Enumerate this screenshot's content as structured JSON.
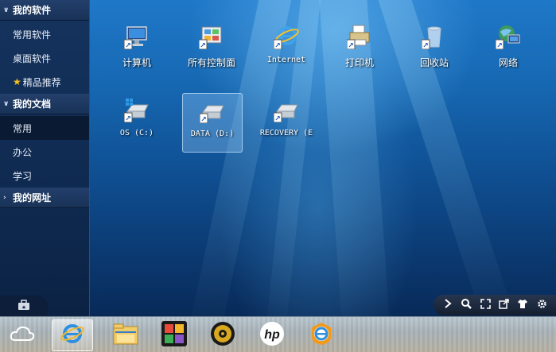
{
  "sidebar": {
    "sections": [
      {
        "title": "我的软件",
        "items": [
          "常用软件",
          "桌面软件",
          "精品推荐"
        ]
      },
      {
        "title": "我的文档",
        "items": [
          "常用",
          "办公",
          "学习"
        ]
      },
      {
        "title": "我的网址",
        "items": []
      }
    ]
  },
  "desktop": {
    "icons": [
      {
        "label": "计算机",
        "icon": "computer-icon"
      },
      {
        "label": "所有控制面",
        "icon": "control-panel-icon"
      },
      {
        "label": "Internet",
        "icon": "ie-icon"
      },
      {
        "label": "打印机",
        "icon": "printer-icon"
      },
      {
        "label": "回收站",
        "icon": "recycle-bin-icon"
      },
      {
        "label": "网络",
        "icon": "network-icon"
      },
      {
        "label": "OS (C:)",
        "icon": "drive-c-icon"
      },
      {
        "label": "DATA (D:)",
        "icon": "drive-d-icon"
      },
      {
        "label": "RECOVERY (E",
        "icon": "drive-e-icon"
      }
    ]
  },
  "toolbar": {
    "buttons": [
      "chevron-right-icon",
      "search-icon",
      "fullscreen-icon",
      "external-link-icon",
      "shirt-icon",
      "gear-icon"
    ]
  },
  "taskbar": {
    "items": [
      "cloud-icon",
      "internet-explorer-icon",
      "file-explorer-icon",
      "puzzle-app-icon",
      "media-player-icon",
      "hp-icon",
      "browser-e-icon"
    ]
  },
  "colors": {
    "sidebar_bg": "#15335e",
    "desktop_bg": "#1769b4",
    "star": "#f6c21a"
  }
}
